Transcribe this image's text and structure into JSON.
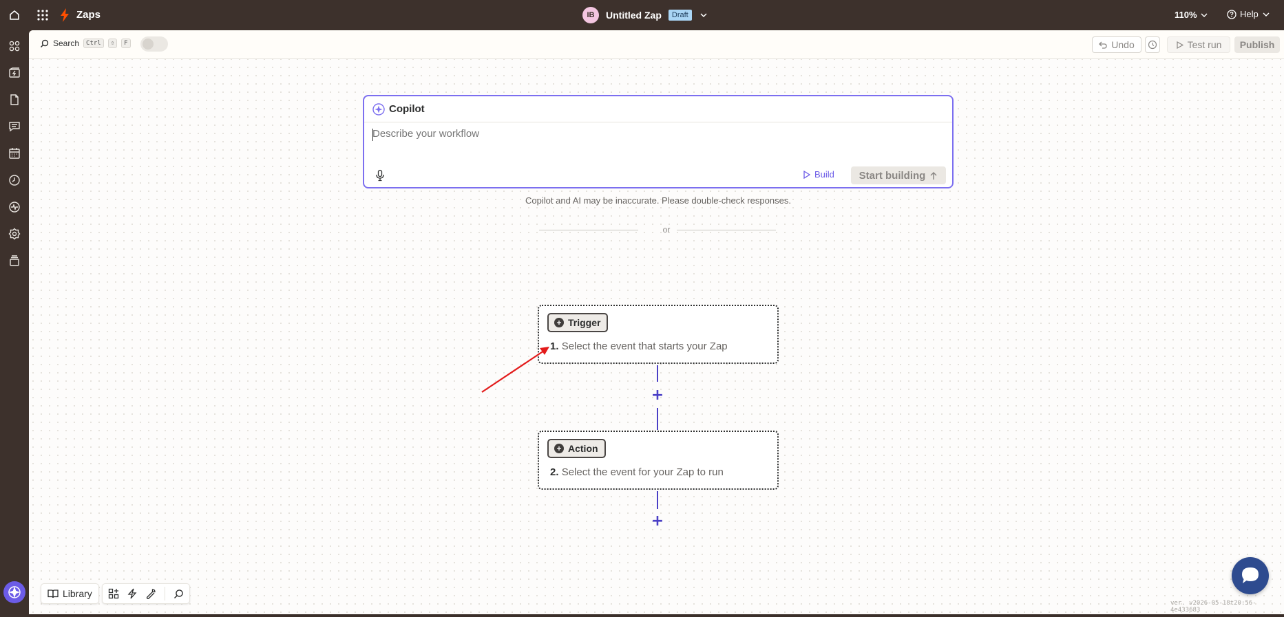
{
  "topbar": {
    "app_title": "Zaps",
    "avatar_initials": "IB",
    "zap_name": "Untitled Zap",
    "status_badge": "Draft",
    "zoom": "110%",
    "help": "Help"
  },
  "toolbar": {
    "search_label": "Search",
    "shortcut_keys": [
      "Ctrl",
      "⇧",
      "F"
    ],
    "undo": "Undo",
    "test_run": "Test run",
    "publish": "Publish"
  },
  "copilot": {
    "title": "Copilot",
    "placeholder": "Describe your workflow",
    "build": "Build",
    "start_building": "Start building",
    "disclaimer": "Copilot and AI may be inaccurate. Please double-check responses.",
    "accent": "#7c6ff0"
  },
  "divider": {
    "text": "or"
  },
  "steps": [
    {
      "badge": "Trigger",
      "number": "1.",
      "description": "Select the event that starts your Zap"
    },
    {
      "badge": "Action",
      "number": "2.",
      "description": "Select the event for your Zap to run"
    }
  ],
  "bottom": {
    "library": "Library",
    "version": "ver. v2026-05-18t20:56-4e433683"
  },
  "sidebar_icons": [
    "apps-icon",
    "zaps-icon",
    "file-icon",
    "chat-icon",
    "calendar-icon",
    "clock-icon",
    "activity-icon",
    "settings-icon",
    "layers-icon",
    "copilot-icon"
  ],
  "colors": {
    "topbar_bg": "#3d312c",
    "brand_orange": "#ff4f00",
    "link_purple": "#6c5ce7",
    "connector": "#4a3fc6",
    "chat_bubble": "#2e4b8f"
  }
}
